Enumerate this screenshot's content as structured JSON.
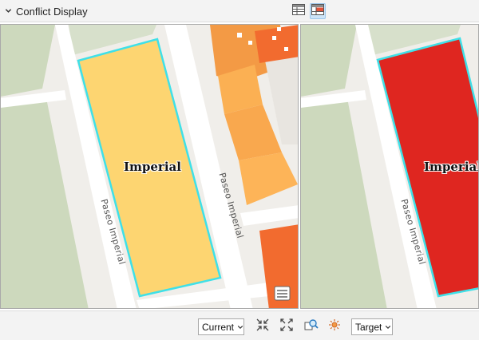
{
  "header": {
    "title": "Conflict Display",
    "collapse_icon": "chevron-down-icon",
    "view_buttons": [
      {
        "name": "table-view-button",
        "icon": "table-icon",
        "active": false
      },
      {
        "name": "highlight-table-button",
        "icon": "table-highlight-icon",
        "active": true
      }
    ]
  },
  "maps": {
    "current": {
      "feature_label": "Imperial",
      "road_labels": [
        "Paseo Imperial",
        "Paseo Imperial"
      ],
      "feature_fill": "#fdd571",
      "outline": "#3fe0e8"
    },
    "target": {
      "feature_label": "Imperial",
      "road_labels": [
        "Paseo Imperial"
      ],
      "feature_fill": "#df2620",
      "outline": "#3fe0e8"
    },
    "attribute_icon": "attribute-table-icon"
  },
  "footer": {
    "left_select": {
      "value": "Current"
    },
    "right_select": {
      "value": "Target"
    },
    "tools": [
      "collapse-extent-icon",
      "expand-extent-icon",
      "zoom-to-feature-icon",
      "flash-icon"
    ]
  },
  "colors": {
    "park": "#cdd9bd",
    "ground": "#f0eeea",
    "road": "#ffffff",
    "building_orange": "#f9a84e",
    "building_red": "#f26b2f"
  }
}
